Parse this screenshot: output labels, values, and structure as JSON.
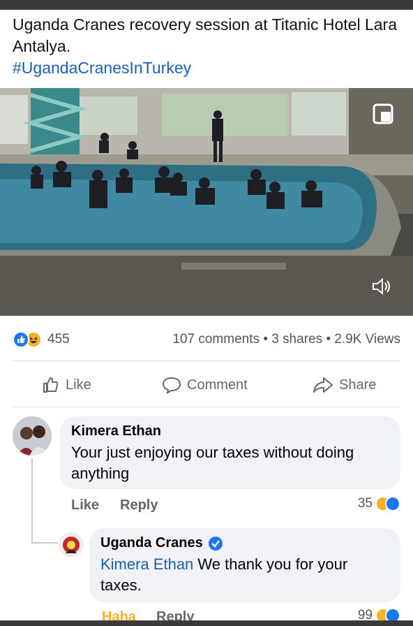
{
  "post": {
    "text": "Uganda Cranes recovery session at Titanic Hotel Lara Antalya.",
    "hashtag": "#UgandaCranesInTurkey"
  },
  "video": {
    "pip_icon": "picture-in-picture-icon",
    "mute_icon": "speaker-muted-icon"
  },
  "stats": {
    "reaction_count": "455",
    "summary": "107 comments • 3 shares • 2.9K Views",
    "reaction_icons": [
      "like-reaction-icon",
      "haha-reaction-icon"
    ]
  },
  "actions": {
    "like": "Like",
    "comment": "Comment",
    "share": "Share"
  },
  "comments": [
    {
      "author": "Kimera Ethan",
      "text": "Your just enjoying our taxes without doing anything",
      "like_label": "Like",
      "reply_label": "Reply",
      "reaction_count": "35"
    }
  ],
  "reply": {
    "author": "Uganda Cranes",
    "mention": "Kimera Ethan",
    "text": " We thank you for your taxes.",
    "haha_label": "Haha",
    "reply_label": "Reply",
    "reaction_count": "99"
  },
  "colors": {
    "brand_blue": "#1877f2",
    "link_blue": "#1a5fb4",
    "haha_yellow": "#f7b125",
    "bubble_bg": "#f0f2f5"
  }
}
